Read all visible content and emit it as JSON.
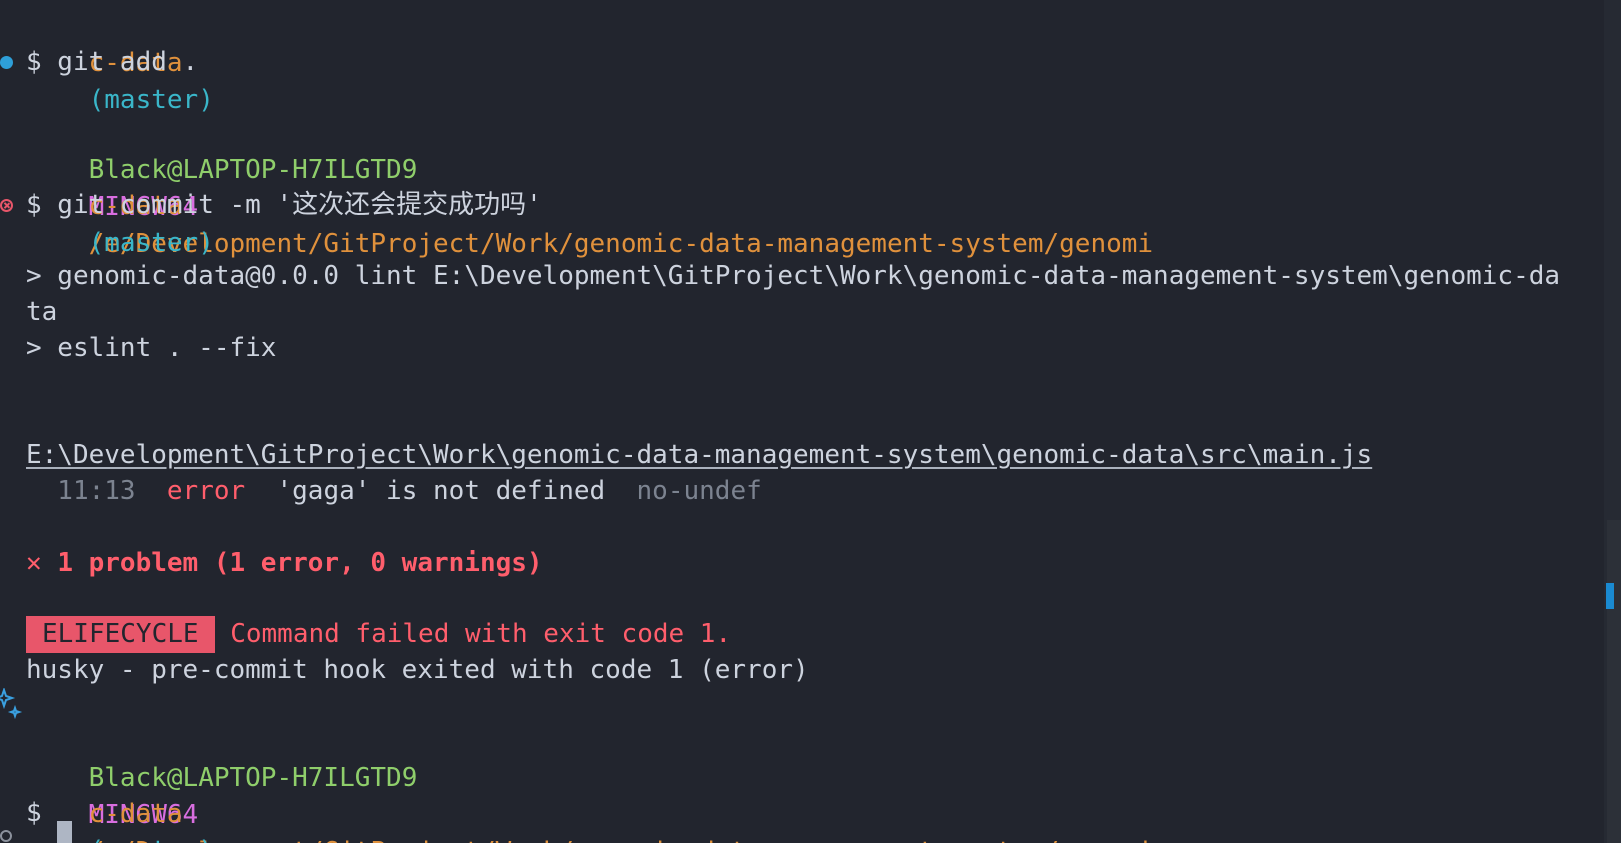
{
  "colors": {
    "background": "#22252e",
    "text": "#cdd3de",
    "user_host": "#8fce6b",
    "env": "#d96ee0",
    "path": "#e0913c",
    "branch": "#3ab6c9",
    "error": "#ff5e6c",
    "badge_bg": "#e8566a"
  },
  "prompt": {
    "user_host": "Black@LAPTOP-H7ILGTD9",
    "env": "MINGW64",
    "path_part1": "/e/Development/GitProject/Work/genomic-data-management-system/genomi",
    "path_part2": "c-data",
    "branch": "(master)",
    "symbol": "$"
  },
  "lines": {
    "top_prompt_tail": "c-data",
    "top_branch": "(master)",
    "cmd_add": " git add .",
    "cmd_commit": " git commit -m '这次还会提交成功吗'",
    "npm_line1": "> genomic-data@0.0.0 lint E:\\Development\\GitProject\\Work\\genomic-data-management-system\\genomic-da",
    "npm_line1_wrap": "ta",
    "npm_line2": "> eslint . --fix",
    "file_path": "E:\\Development\\GitProject\\Work\\genomic-data-management-system\\genomic-data\\src\\main.js",
    "error_pos": "  11:13",
    "error_label": "error",
    "error_msg": "'gaga' is not defined",
    "error_rule": "no-undef",
    "problem_summary": "1 problem (1 error, 0 warnings)",
    "badge": "ELIFECYCLE",
    "command_failed": "Command failed with exit code 1.",
    "husky": "husky - pre-commit hook exited with code 1 (error)"
  },
  "icons": {
    "status_success": "blue-dot-icon",
    "status_error": "error-circle-icon",
    "status_pending": "hollow-circle-icon",
    "sparkle": "sparkle-icon",
    "problem": "cross-icon"
  }
}
